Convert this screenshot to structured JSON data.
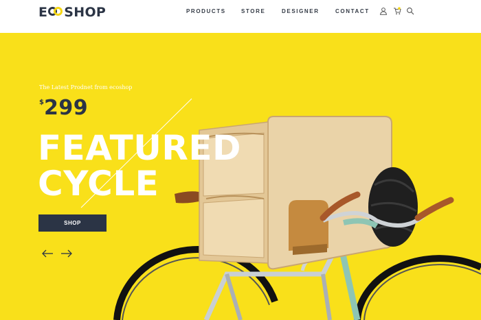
{
  "brand": {
    "logo_left": "E",
    "logo_right": "SHOP",
    "colors": {
      "dark": "#2b3445",
      "accent": "#f9e01a",
      "white": "#ffffff"
    }
  },
  "nav": {
    "items": [
      {
        "label": "PRODUCTS"
      },
      {
        "label": "STORE"
      },
      {
        "label": "DESIGNER"
      },
      {
        "label": "CONTACT"
      }
    ],
    "icons": [
      "user-icon",
      "cart-icon",
      "search-icon"
    ]
  },
  "hero": {
    "tagline": "The Latest Prodnet from ecoshop",
    "price_currency": "$",
    "price_amount": "299",
    "headline_line1": "FEATURED",
    "headline_line2": "CYCLE",
    "shop_label": "SHOP",
    "prev_icon": "arrow-left-icon",
    "next_icon": "arrow-right-icon"
  }
}
